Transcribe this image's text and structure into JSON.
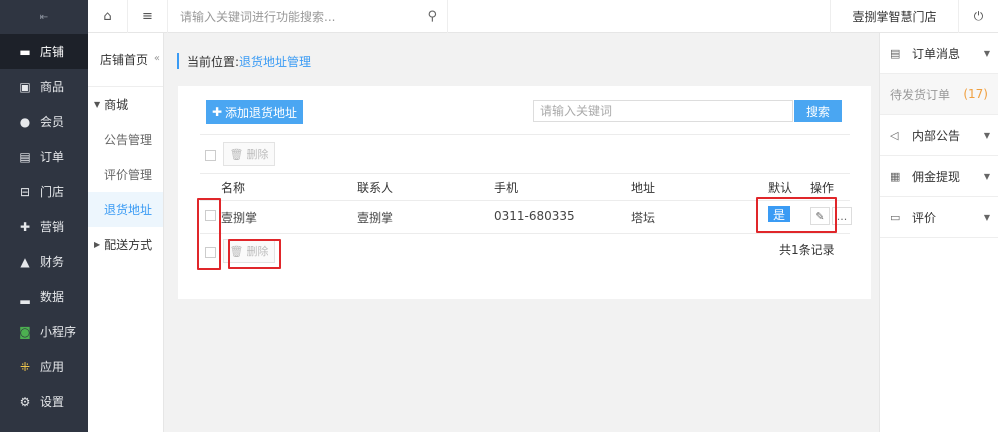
{
  "sidebar": {
    "collapse_icon": "collapse-icon",
    "items": [
      {
        "label": "店铺",
        "icon": "store-icon",
        "active": true
      },
      {
        "label": "商品",
        "icon": "goods-icon"
      },
      {
        "label": "会员",
        "icon": "member-icon"
      },
      {
        "label": "订单",
        "icon": "order-icon"
      },
      {
        "label": "门店",
        "icon": "shop-icon"
      },
      {
        "label": "营销",
        "icon": "gift-icon"
      },
      {
        "label": "财务",
        "icon": "finance-icon"
      },
      {
        "label": "数据",
        "icon": "chart-icon"
      },
      {
        "label": "小程序",
        "icon": "miniapp-icon"
      },
      {
        "label": "应用",
        "icon": "apps-icon"
      },
      {
        "label": "设置",
        "icon": "gear-icon"
      }
    ]
  },
  "topbar": {
    "search_placeholder": "请输入关键词进行功能搜索...",
    "store_name": "壹捌掌智慧门店"
  },
  "subnav": {
    "head": "店铺首页",
    "group1": "商城",
    "links": [
      "公告管理",
      "评价管理",
      "退货地址"
    ],
    "group2": "配送方式"
  },
  "breadcrumb": {
    "prefix": "当前位置:",
    "current": "退货地址管理"
  },
  "main": {
    "add_label": "添加退货地址",
    "keyword_placeholder": "请输入关键词",
    "search_label": "搜索",
    "delete_label": "删除",
    "columns": [
      "名称",
      "联系人",
      "手机",
      "地址",
      "默认",
      "操作"
    ],
    "row": {
      "name": "壹捌掌",
      "contact": "壹捌掌",
      "phone": "0311-680335",
      "address": "塔坛",
      "default": "是"
    },
    "more_label": "...",
    "total": "共1条记录"
  },
  "right_panel": {
    "order_msg": "订单消息",
    "pending_label": "待发货订单",
    "pending_count": "(17)",
    "notice": "内部公告",
    "commission": "佣金提现",
    "review": "评价"
  },
  "colors": {
    "accent": "#3a9bf4",
    "sidebar": "#2f3541",
    "highlight": "#e0262a"
  }
}
